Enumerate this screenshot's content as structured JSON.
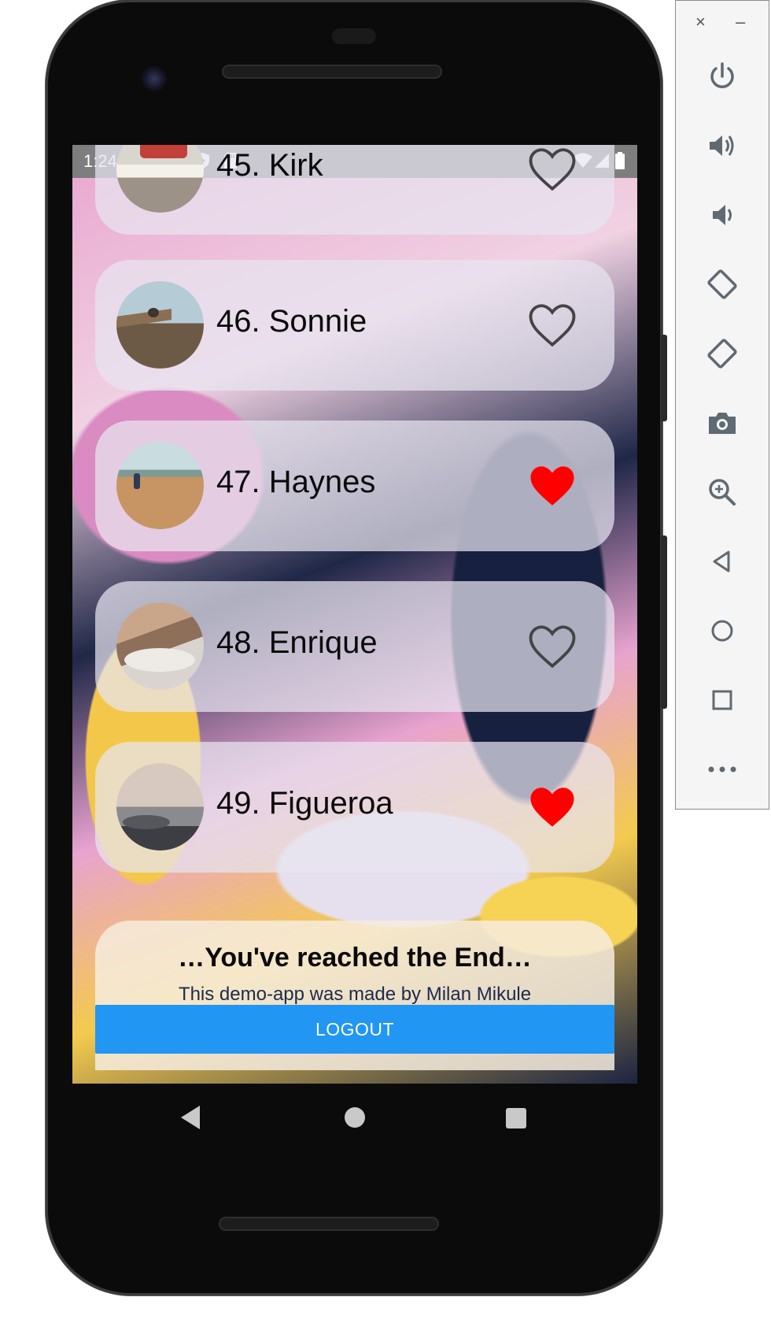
{
  "status_bar": {
    "time": "1:24"
  },
  "items": [
    {
      "label": "45. Kirk",
      "liked": false
    },
    {
      "label": "46. Sonnie",
      "liked": false
    },
    {
      "label": "47. Haynes",
      "liked": true
    },
    {
      "label": "48. Enrique",
      "liked": false
    },
    {
      "label": "49. Figueroa",
      "liked": true
    }
  ],
  "footer": {
    "title": "…You've reached the End…",
    "subtitle": "This demo-app was made by Milan Mikule",
    "logout_label": "LOGOUT"
  },
  "emulator": {
    "close_glyph": "×",
    "minimize_glyph": "–",
    "tools": [
      "power-icon",
      "volume-up-icon",
      "volume-down-icon",
      "rotate-left-icon",
      "rotate-right-icon",
      "screenshot-icon",
      "zoom-icon",
      "back-icon",
      "home-icon",
      "overview-icon",
      "more-icon"
    ]
  },
  "colors": {
    "heart_liked": "#ff0000",
    "heart_outline": "#444444",
    "logout_bg": "#2196f3",
    "status_bar": "#7e7e7e"
  }
}
